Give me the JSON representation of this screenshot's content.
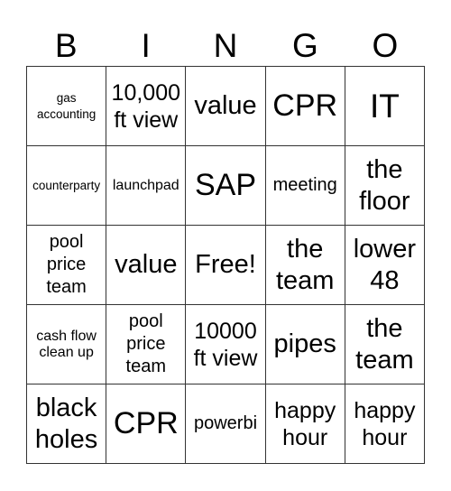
{
  "header": [
    "B",
    "I",
    "N",
    "G",
    "O"
  ],
  "cells": [
    {
      "text": "gas accounting",
      "size": "s1"
    },
    {
      "text": "10,000 ft view",
      "size": "s4"
    },
    {
      "text": "value",
      "size": "s5"
    },
    {
      "text": "CPR",
      "size": "s6"
    },
    {
      "text": "IT",
      "size": "s7"
    },
    {
      "text": "counterparty",
      "size": "s1"
    },
    {
      "text": "launchpad",
      "size": "s2"
    },
    {
      "text": "SAP",
      "size": "s6"
    },
    {
      "text": "meeting",
      "size": "s3"
    },
    {
      "text": "the floor",
      "size": "s5"
    },
    {
      "text": "pool price team",
      "size": "s3"
    },
    {
      "text": "value",
      "size": "s5"
    },
    {
      "text": "Free!",
      "size": "s5"
    },
    {
      "text": "the team",
      "size": "s5"
    },
    {
      "text": "lower 48",
      "size": "s5"
    },
    {
      "text": "cash flow clean up",
      "size": "s2"
    },
    {
      "text": "pool price team",
      "size": "s3"
    },
    {
      "text": "10000 ft view",
      "size": "s4"
    },
    {
      "text": "pipes",
      "size": "s5"
    },
    {
      "text": "the team",
      "size": "s5"
    },
    {
      "text": "black holes",
      "size": "s5"
    },
    {
      "text": "CPR",
      "size": "s6"
    },
    {
      "text": "powerbi",
      "size": "s3"
    },
    {
      "text": "happy hour",
      "size": "s4"
    },
    {
      "text": "happy hour",
      "size": "s4"
    }
  ]
}
